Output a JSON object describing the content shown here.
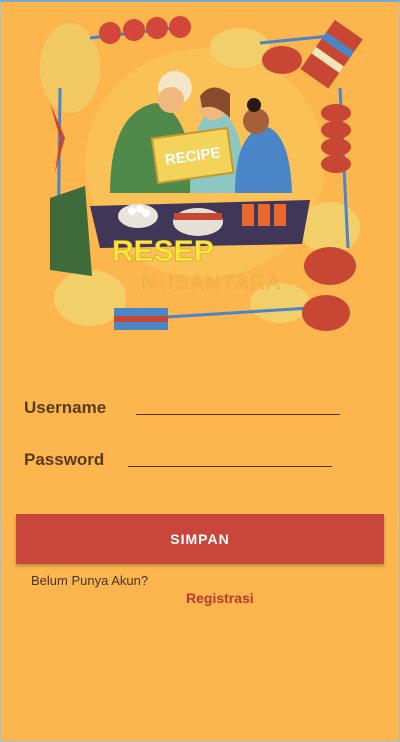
{
  "hero": {
    "title_main": "RESEP",
    "title_sub": "NUSANTARA",
    "recipe_card_text": "RECIPE"
  },
  "form": {
    "username_label": "Username",
    "username_value": "",
    "password_label": "Password",
    "password_value": ""
  },
  "actions": {
    "submit_label": "SIMPAN",
    "no_account_text": "Belum Punya Akun?",
    "register_link": "Registrasi"
  },
  "colors": {
    "background": "#fdb54e",
    "button": "#c8473a",
    "link": "#c0392b",
    "title_yellow": "#ffe63a"
  }
}
